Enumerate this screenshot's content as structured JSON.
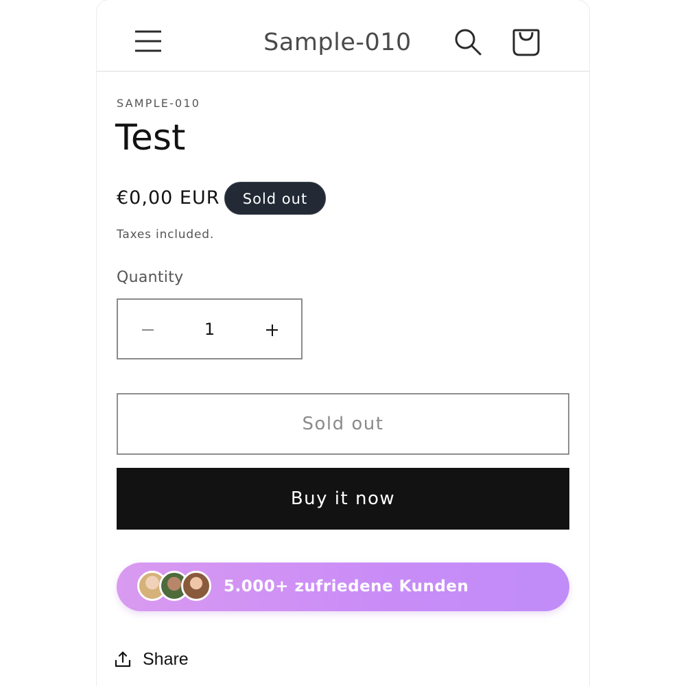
{
  "header": {
    "store_title": "Sample-010",
    "icons": [
      "menu-icon",
      "search-icon",
      "cart-icon"
    ]
  },
  "product": {
    "vendor": "SAMPLE-010",
    "title": "Test",
    "price": "€0,00 EUR",
    "badge": "Sold out",
    "taxes_note": "Taxes included."
  },
  "quantity": {
    "label": "Quantity",
    "value": "1"
  },
  "buttons": {
    "sold_out_label": "Sold out",
    "buy_now_label": "Buy it now"
  },
  "social_proof": {
    "text": "5.000+ zufriedene Kunden",
    "avatars": 3
  },
  "share": {
    "label": "Share",
    "icon": "share-icon"
  },
  "colors": {
    "badge_bg": "#232a36",
    "buy_button_bg": "#121212",
    "banner_gradient_start": "#d99af0",
    "banner_gradient_end": "#c08cf8"
  }
}
